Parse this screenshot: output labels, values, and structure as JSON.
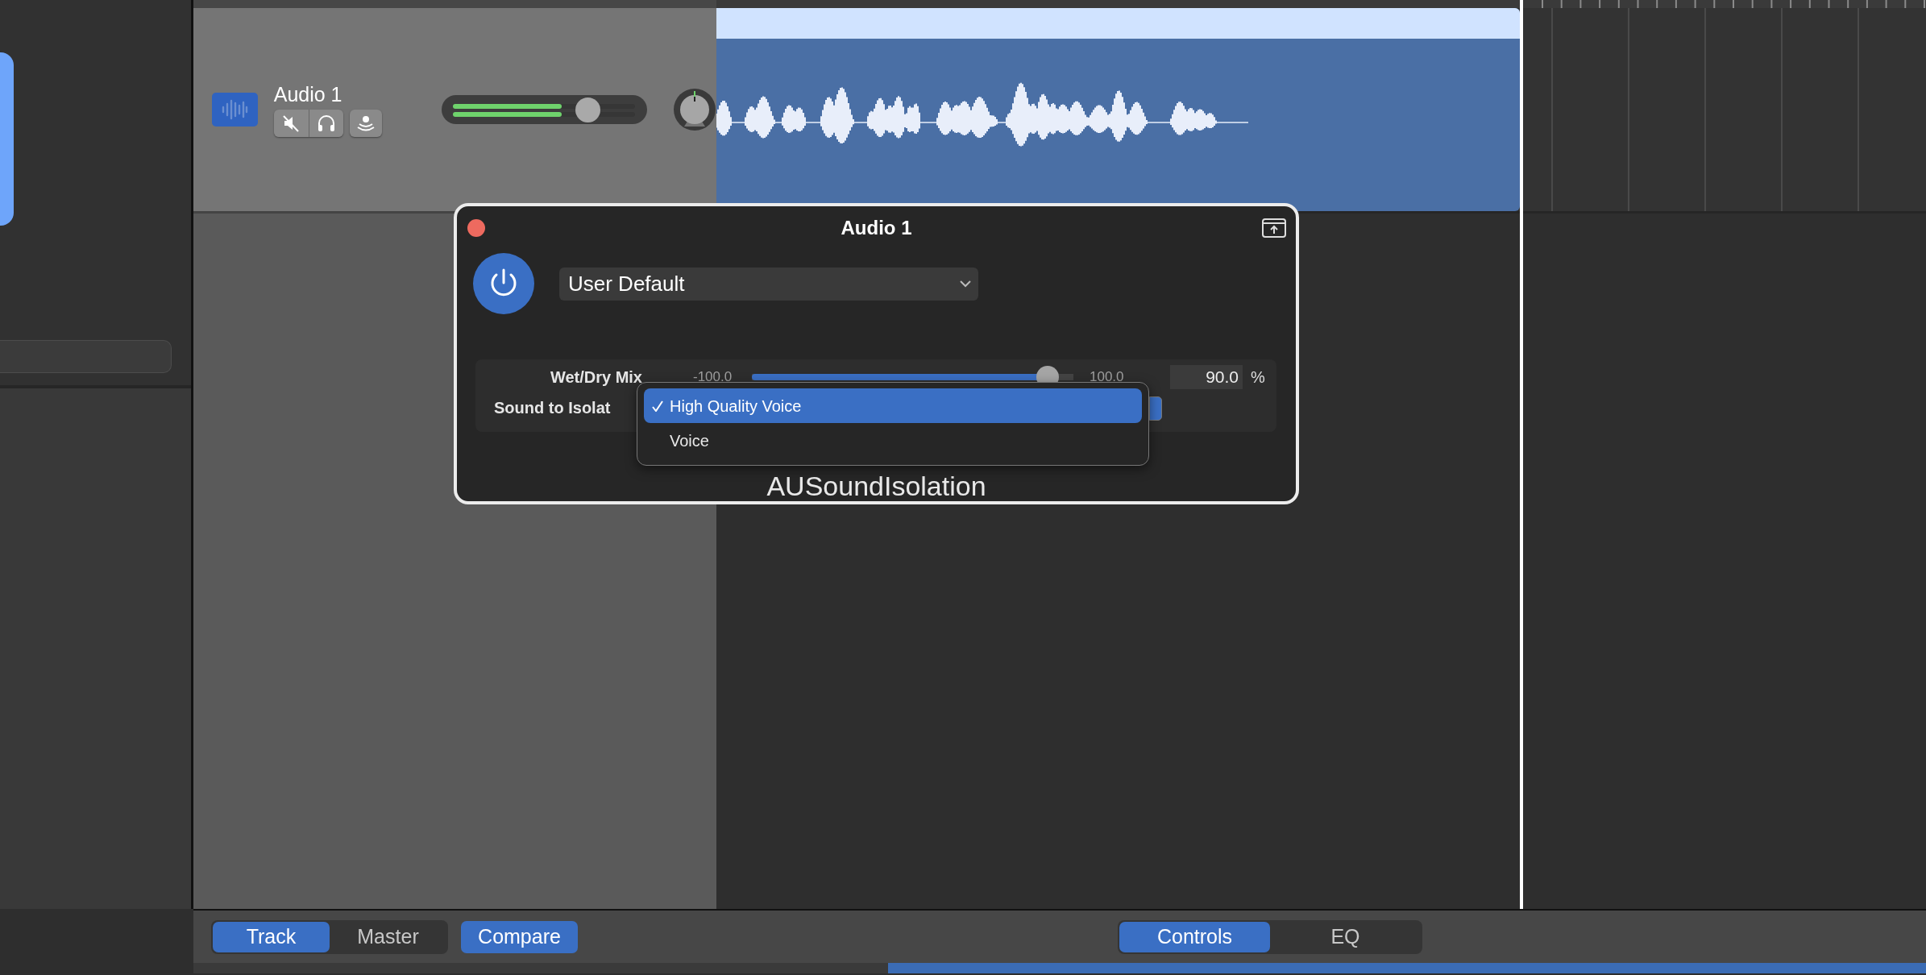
{
  "track": {
    "name": "Audio 1",
    "meter": {
      "level": 0.6
    },
    "volume": {
      "level": 0.71
    }
  },
  "plugin_window": {
    "title": "Audio 1",
    "power_on": true,
    "preset": "User Default",
    "parameters": [
      {
        "kind": "slider",
        "label": "Wet/Dry Mix",
        "min_label": "-100.0",
        "max_label": "100.0",
        "level": 0.92,
        "value": "90.0",
        "unit": "%"
      },
      {
        "kind": "popup",
        "label": "Sound to Isolat"
      }
    ],
    "plugin_name": "AUSoundIsolation"
  },
  "popup_menu": {
    "items": [
      {
        "label": "High Quality Voice",
        "checked": true,
        "selected": true
      },
      {
        "label": "Voice",
        "checked": false,
        "selected": false
      }
    ]
  },
  "bottom_bar": {
    "left_segments": [
      {
        "label": "Track",
        "selected": true
      },
      {
        "label": "Master",
        "selected": false
      }
    ],
    "compare": {
      "label": "Compare",
      "on": true
    },
    "right_segments": [
      {
        "label": "Controls",
        "selected": true
      },
      {
        "label": "EQ",
        "selected": false
      }
    ]
  }
}
